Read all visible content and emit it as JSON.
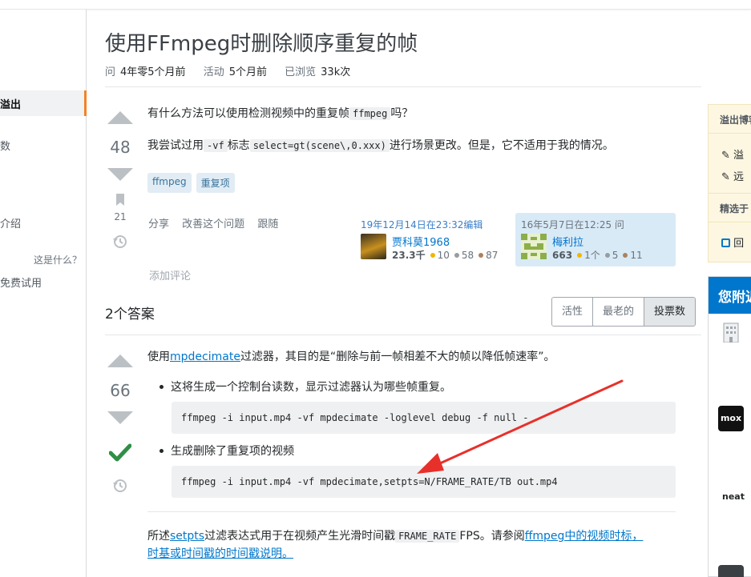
{
  "question": {
    "title": "使用FFmpeg时删除顺序重复的帧",
    "meta": {
      "asked_label": "问",
      "asked_value": "4年零5个月前",
      "active_label": "活动",
      "active_value": "5个月前",
      "viewed_label": "已浏览",
      "viewed_value": "33k次"
    },
    "votes": "48",
    "bookmarks": "21",
    "body_line1_pre": "有什么方法可以使用检测视频中的重复帧",
    "body_line1_code": "ffmpeg",
    "body_line1_post": "吗？",
    "body_line2_pre": "我尝试过用",
    "body_line2_code1": "-vf",
    "body_line2_mid": "标志",
    "body_line2_code2": "select=gt(scene\\,0.xxx)",
    "body_line2_post": "进行场景更改。但是，它不适用于我的情况。",
    "tags": [
      "ffmpeg",
      "重复项"
    ],
    "menu": [
      "分享",
      "改善这个问题",
      "跟随"
    ],
    "add_comment": "添加评论",
    "editor": {
      "time": "19年12月14日在23:32编辑",
      "name": "贾科莫1968",
      "rep": "23.3千",
      "gold": "10",
      "silver": "58",
      "bronze": "87"
    },
    "asker": {
      "time": "16年5月7日在12:25 问",
      "name": "梅利拉",
      "rep": "663",
      "gold": "1个",
      "silver": "5",
      "bronze": "11"
    }
  },
  "answers_header": {
    "count_label": "2个答案",
    "sort": [
      "活性",
      "最老的",
      "投票数"
    ],
    "active_sort": "投票数"
  },
  "answer": {
    "votes": "66",
    "intro_pre": "使用",
    "intro_link": "mpdecimate",
    "intro_post": "过滤器，其目的是“删除与前一帧相差不大的帧以降低帧速率”。",
    "bullet1": "这将生成一个控制台读数，显示过滤器认为哪些帧重复。",
    "code1": "ffmpeg -i input.mp4 -vf mpdecimate -loglevel debug -f null -",
    "bullet2": "生成删除了重复项的视频",
    "code2": "ffmpeg -i input.mp4 -vf mpdecimate,setpts=N/FRAME_RATE/TB out.mp4",
    "footer_pre": "所述",
    "footer_link1": "setpts",
    "footer_mid": "过滤表达式用于在视频产生光滑时间戳",
    "footer_code": "FRAME_RATE",
    "footer_post": "FPS。请参阅",
    "footer_link2a": "ffmpeg中的视频时标，",
    "footer_link2b": "时基或时间戳的时间戳说明。"
  },
  "left_nav": {
    "active": "溢出",
    "item1": "数",
    "item2": "介绍",
    "whats_this": "这是什么？",
    "free_trial": "免费试用"
  },
  "sidebar": {
    "blog_title": "溢出博客",
    "item1": "溢",
    "item2": "远",
    "featured": "精选于",
    "item3": "回",
    "near_title": "您附近",
    "logo1": "mox",
    "logo2": "neat"
  },
  "colors": {
    "accent_orange": "#f48225",
    "accept_green": "#2f6f44",
    "link_blue": "#0077cc",
    "annotation_red": "#e8302a"
  }
}
